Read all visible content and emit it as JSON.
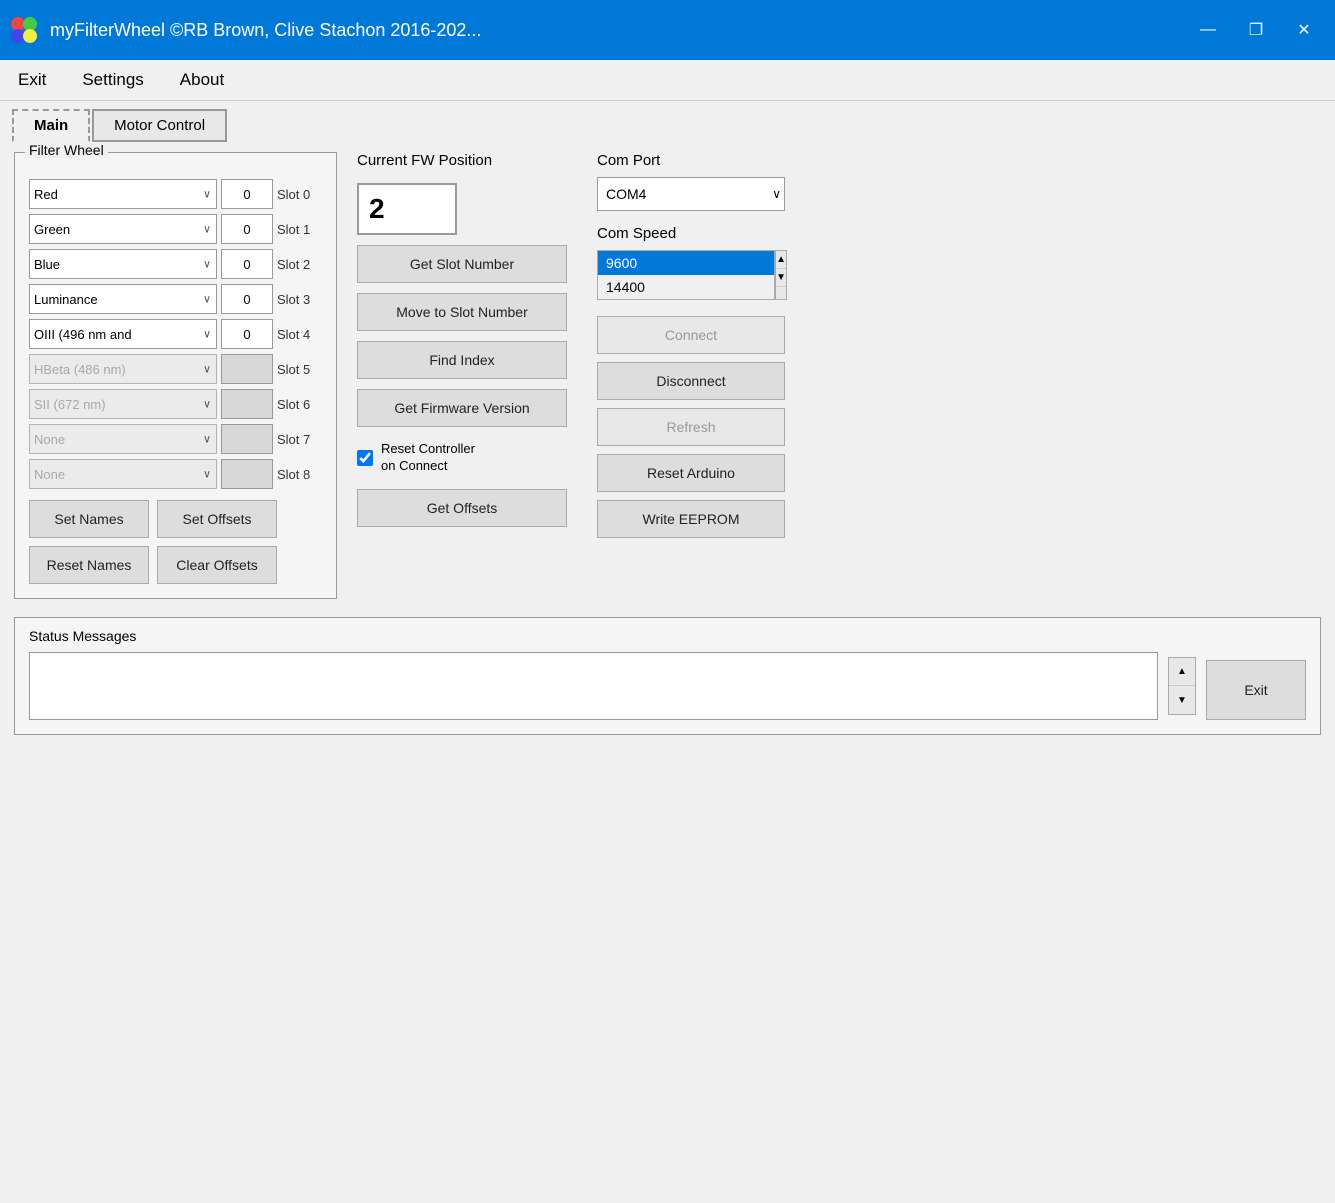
{
  "titleBar": {
    "title": "myFilterWheel ©RB Brown, Clive Stachon 2016-202...",
    "icon": "🎨",
    "minimizeBtn": "—",
    "restoreBtn": "❐",
    "closeBtn": "✕"
  },
  "menuBar": {
    "items": [
      "Exit",
      "Settings",
      "About"
    ]
  },
  "tabs": [
    {
      "label": "Main",
      "active": true
    },
    {
      "label": "Motor Control",
      "active": false
    }
  ],
  "filterWheel": {
    "groupLabel": "Filter Wheel",
    "slots": [
      {
        "name": "Red",
        "offset": "0",
        "slotLabel": "Slot 0",
        "enabled": true
      },
      {
        "name": "Green",
        "offset": "0",
        "slotLabel": "Slot 1",
        "enabled": true
      },
      {
        "name": "Blue",
        "offset": "0",
        "slotLabel": "Slot 2",
        "enabled": true
      },
      {
        "name": "Luminance",
        "offset": "0",
        "slotLabel": "Slot 3",
        "enabled": true
      },
      {
        "name": "OIII (496 nm and",
        "offset": "0",
        "slotLabel": "Slot 4",
        "enabled": true
      },
      {
        "name": "HBeta (486 nm)",
        "offset": "",
        "slotLabel": "Slot 5",
        "enabled": false
      },
      {
        "name": "SII (672 nm)",
        "offset": "",
        "slotLabel": "Slot 6",
        "enabled": false
      },
      {
        "name": "None",
        "offset": "",
        "slotLabel": "Slot 7",
        "enabled": false
      },
      {
        "name": "None",
        "offset": "",
        "slotLabel": "Slot 8",
        "enabled": false
      }
    ],
    "buttons": {
      "setNames": "Set Names",
      "setOffsets": "Set Offsets",
      "resetNames": "Reset Names",
      "clearOffsets": "Clear Offsets"
    }
  },
  "fwPosition": {
    "label": "Current FW Position",
    "value": "2",
    "buttons": {
      "getSlotNumber": "Get Slot Number",
      "moveToSlotNumber": "Move to Slot Number",
      "findIndex": "Find Index",
      "getFirmwareVersion": "Get Firmware Version",
      "getOffsets": "Get Offsets"
    },
    "resetController": {
      "checked": true,
      "label": "Reset Controller\non Connect"
    }
  },
  "comPort": {
    "label": "Com Port",
    "selectedPort": "COM4",
    "ports": [
      "COM4"
    ],
    "speedLabel": "Com Speed",
    "speeds": [
      "9600",
      "14400"
    ],
    "selectedSpeed": "9600",
    "buttons": {
      "connect": "Connect",
      "disconnect": "Disconnect",
      "refresh": "Refresh",
      "resetArduino": "Reset Arduino",
      "writeEEPROM": "Write EEPROM"
    }
  },
  "statusBar": {
    "label": "Status Messages",
    "exitBtn": "Exit"
  }
}
